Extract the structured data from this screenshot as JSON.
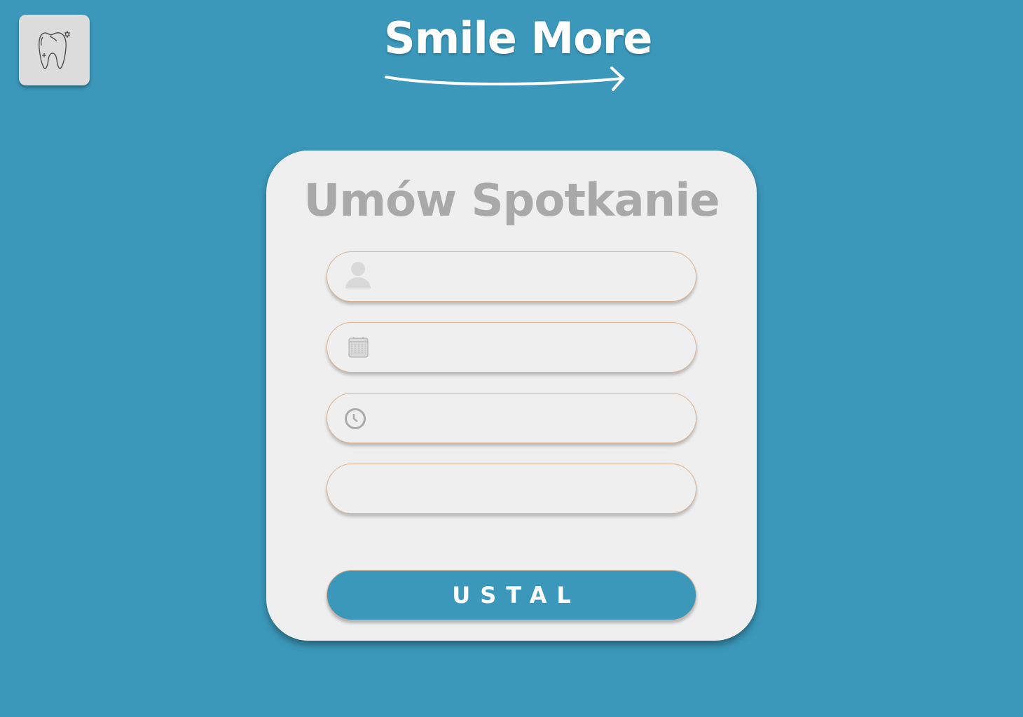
{
  "header": {
    "brand": "Smile More",
    "logo_icon": "tooth-icon"
  },
  "form": {
    "title": "Umów Spotkanie",
    "fields": [
      {
        "icon": "user-icon",
        "value": "",
        "placeholder": ""
      },
      {
        "icon": "calendar-icon",
        "value": "",
        "placeholder": ""
      },
      {
        "icon": "clock-icon",
        "value": "",
        "placeholder": ""
      },
      {
        "icon": "",
        "value": "",
        "placeholder": ""
      }
    ],
    "submit_label": "USTAL"
  },
  "colors": {
    "background": "#3b98ba",
    "card": "#efefef",
    "field_border": "#dcb393",
    "title": "#a9a9a9"
  }
}
